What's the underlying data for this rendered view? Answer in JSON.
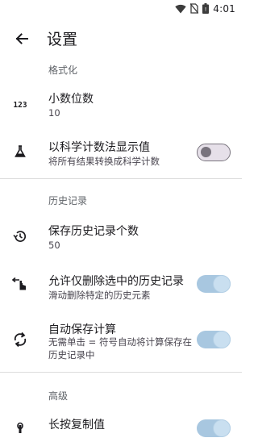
{
  "status_bar": {
    "time": "4:01"
  },
  "header": {
    "title": "设置"
  },
  "sections": {
    "format": "格式化",
    "history": "历史记录",
    "advanced": "高级"
  },
  "settings": {
    "decimal_places": {
      "title": "小数位数",
      "value": "10"
    },
    "scientific": {
      "title": "以科学计数法显示值",
      "subtitle": "将所有结果转换成科学计数",
      "enabled": false
    },
    "history_count": {
      "title": "保存历史记录个数",
      "value": "50"
    },
    "delete_selected": {
      "title": "允许仅删除选中的历史记录",
      "subtitle": "滑动删除特定的历史元素",
      "enabled": true
    },
    "auto_save": {
      "title": "自动保存计算",
      "subtitle": "无需单击 = 符号自动将计算保存在历史记录中",
      "enabled": true
    },
    "long_press_copy": {
      "title": "长按复制值",
      "enabled": true
    }
  },
  "icons": {
    "decimal": "decimal-123-icon",
    "scientific": "flask-icon",
    "history_count": "history-icon",
    "delete_selected": "swipe-left-icon",
    "auto_save": "sync-icon",
    "long_press": "touch-icon"
  }
}
